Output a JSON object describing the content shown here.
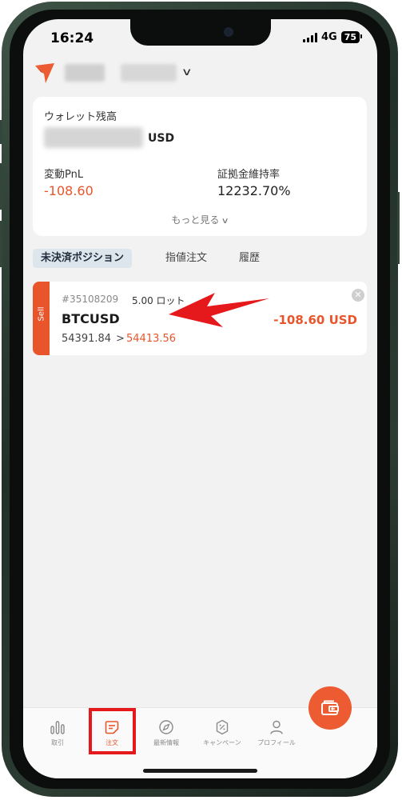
{
  "status_bar": {
    "time": "16:24",
    "network": "4G",
    "battery": "75"
  },
  "header": {
    "account_selector_icon": "chevron-down-icon"
  },
  "wallet": {
    "balance_label": "ウォレット残高",
    "balance_currency": "USD",
    "pnl_label": "変動PnL",
    "pnl_value": "-108.60",
    "margin_label": "証拠金維持率",
    "margin_value": "12232.70%",
    "show_more": "もっと見る"
  },
  "tabs": [
    {
      "label": "未決済ポジション",
      "active": true
    },
    {
      "label": "指値注文",
      "active": false
    },
    {
      "label": "履歴",
      "active": false
    }
  ],
  "position": {
    "side": "Sell",
    "ticket": "#35108209",
    "lots": "5.00 ロット",
    "symbol": "BTCUSD",
    "open_price": "54391.84",
    "separator": ">",
    "current_price": "54413.56",
    "pnl": "-108.60 USD"
  },
  "fab": {
    "icon": "wallet-transfer-icon"
  },
  "nav": [
    {
      "label": "取引",
      "icon": "chart-bars-icon",
      "active": false
    },
    {
      "label": "注文",
      "icon": "order-note-icon",
      "active": true
    },
    {
      "label": "最新情報",
      "icon": "compass-icon",
      "active": false
    },
    {
      "label": "キャンペーン",
      "icon": "coupon-badge-icon",
      "active": false
    },
    {
      "label": "プロフィール",
      "icon": "person-icon",
      "active": false
    }
  ],
  "colors": {
    "accent": "#e8552b",
    "highlight_box": "#e5181b",
    "annotation_arrow": "#e5181b"
  }
}
